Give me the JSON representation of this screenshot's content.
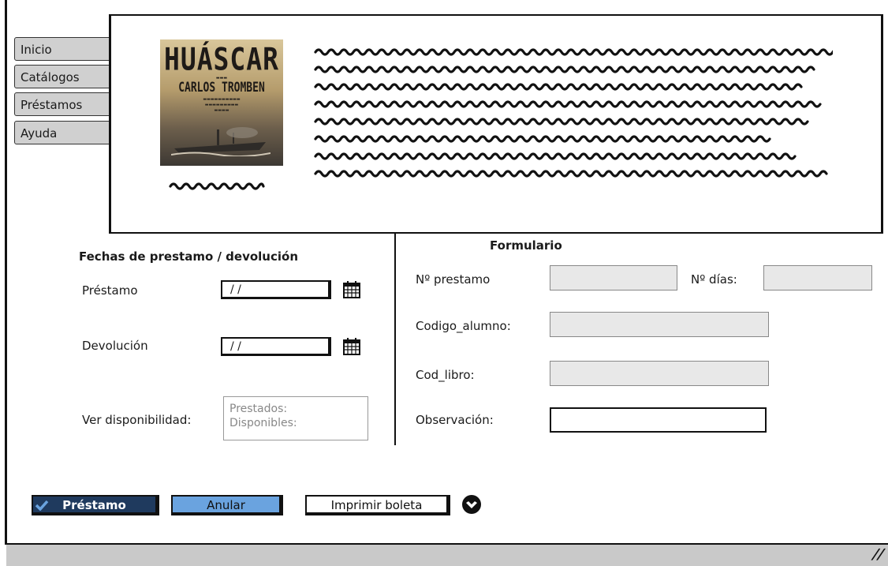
{
  "nav": {
    "tabs": [
      {
        "label": "Inicio"
      },
      {
        "label": "Catálogos"
      },
      {
        "label": "Préstamos"
      },
      {
        "label": "Ayuda"
      }
    ]
  },
  "book": {
    "cover_title": "HUÁSCAR",
    "cover_author": "CARLOS TROMBEN"
  },
  "dates": {
    "heading": "Fechas de prestamo / devolución",
    "loan_label": "Préstamo",
    "loan_value": "/ /",
    "return_label": "Devolución",
    "return_value": "/ /",
    "availability_label": "Ver disponibilidad:",
    "availability_lent": "Prestados:",
    "availability_available": "Disponibles:"
  },
  "form": {
    "heading": "Formulario",
    "loan_number_label": "Nº prestamo",
    "days_label": "Nº días:",
    "student_code_label": "Codigo_alumno:",
    "book_code_label": "Cod_libro:",
    "observation_label": "Observación:"
  },
  "actions": {
    "loan_button": "Préstamo",
    "cancel_button": "Anular",
    "print_button": "Imprimir boleta"
  },
  "icons": {
    "calendar": "calendar-icon",
    "download": "arrow-down-circle-icon",
    "check": "check-icon"
  },
  "colors": {
    "primary_button": "#1f3a5e",
    "cancel_button": "#6aa3df",
    "field_fill": "#e8e8e8",
    "tab_fill": "#d0d0d0"
  }
}
